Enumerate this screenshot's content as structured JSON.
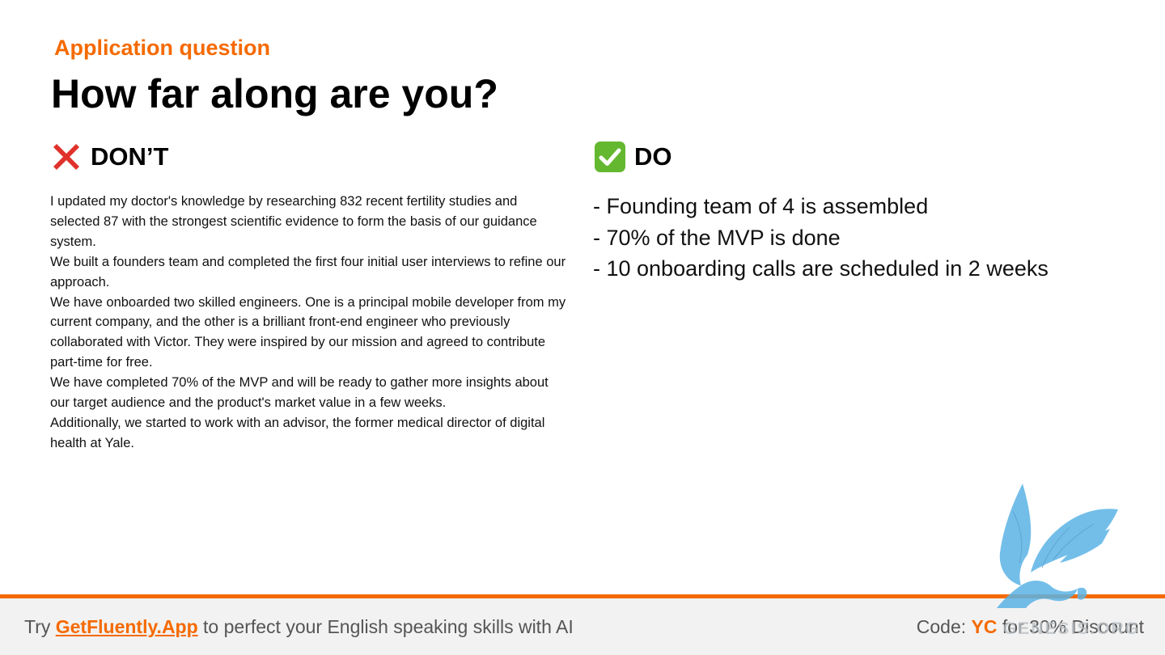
{
  "header": {
    "kicker": "Application question",
    "title": "How far along are you?"
  },
  "dont": {
    "heading": "DON’T",
    "icon": "cross-mark-icon",
    "paragraphs": [
      "I updated my doctor's knowledge by researching 832 recent fertility studies and selected 87 with the strongest scientific evidence to form the basis of our guidance system.",
      "We built a founders team and completed the first four initial user interviews to refine our approach.",
      "We have onboarded two skilled engineers. One is a principal mobile developer from my current company, and the other is a brilliant front-end engineer who previously collaborated with Victor. They were inspired by our mission and agreed to contribute part-time for free.",
      "We have completed 70% of the MVP and will be ready to gather more insights about our target audience and the product's market value in a few weeks.",
      "Additionally, we started to work with an advisor, the former medical director of digital health at Yale."
    ]
  },
  "do": {
    "heading": "DO",
    "icon": "check-mark-icon",
    "items": [
      "- Founding team of 4 is assembled",
      "- 70% of the MVP is done",
      "- 10 onboarding calls are scheduled in 2 weeks"
    ]
  },
  "footer": {
    "prefix": "Try ",
    "link": "GetFluently.App",
    "suffix": " to perfect your English speaking skills with AI",
    "code_prefix": "Code: ",
    "code": "YC",
    "code_suffix": " for 30% Discount"
  },
  "watermark": {
    "icon": "griffin-logo-icon",
    "text": "GENESIS.ORG"
  },
  "colors": {
    "accent": "#f56a00",
    "footer_bg": "#f2f2f2",
    "footer_text": "#555555",
    "cross": "#e0312b",
    "check": "#64b830",
    "watermark": "#5bb3e6"
  }
}
